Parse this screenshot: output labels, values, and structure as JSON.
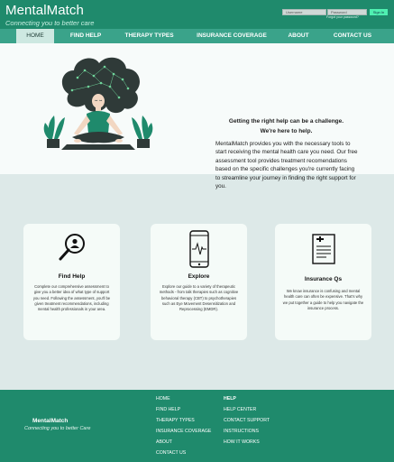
{
  "header": {
    "brand_name": "MentalMatch",
    "tagline": "Connecting you to better care",
    "username_placeholder": "Username",
    "password_placeholder": "Password",
    "signin_label": "Sign In",
    "forgot_label": "Forgot your password?"
  },
  "nav": {
    "items": [
      {
        "label": "HOME",
        "active": true
      },
      {
        "label": "FIND HELP"
      },
      {
        "label": "THERAPY TYPES"
      },
      {
        "label": "INSURANCE COVERAGE"
      },
      {
        "label": "ABOUT"
      },
      {
        "label": "CONTACT US"
      }
    ]
  },
  "hero": {
    "headline_1": "Getting the right help can be a challenge.",
    "headline_2": "We're here to help.",
    "body": "MentalMatch provides you with the necessary tools to start receiving the mental health care you need. Our free assessment tool provides treatment recomendations based on the specific challenges you're currently facing to streamline your journey in finding the right support for you."
  },
  "cards": [
    {
      "title": "Find Help",
      "icon": "magnifier-person-icon",
      "text": "Complete our comprehensive assessment to give you a better idea of what type of support you need. Following the assessment, you'll be given treatment recommendations, including mental health professionals in your area."
    },
    {
      "title": "Explore",
      "icon": "phone-heartbeat-icon",
      "text": "Explore our guide to a variety of therapeutic methods - from talk therapies such as cognitive behavioral therapy (CBT) to psychotherapies such as Eye Movement Desensitization and Reprocessing (EMDR)."
    },
    {
      "title": "Insurance  Qs",
      "icon": "medical-document-icon",
      "text": "We know insurance is confusing and mental health care can often be expensive. That's why we put together a guide to help you navigate the insurance process."
    }
  ],
  "footer": {
    "brand_name": "MentalMatch",
    "tagline": "Connecting you to better Care",
    "col1": [
      "HOME",
      "FIND HELP",
      "THERAPY TYPES",
      "INSURANCE COVERAGE",
      "ABOUT",
      "CONTACT US"
    ],
    "col2_heading": "HELP",
    "col2": [
      "HELP CENTER",
      "CONTACT SUPPORT",
      "INSTRUCTIONS",
      "HOW IT WORKS"
    ]
  },
  "colors": {
    "primary": "#1f8a6c",
    "nav": "#3aa38a",
    "accent": "#4ff0b1",
    "page_bg": "#dde9e8"
  }
}
